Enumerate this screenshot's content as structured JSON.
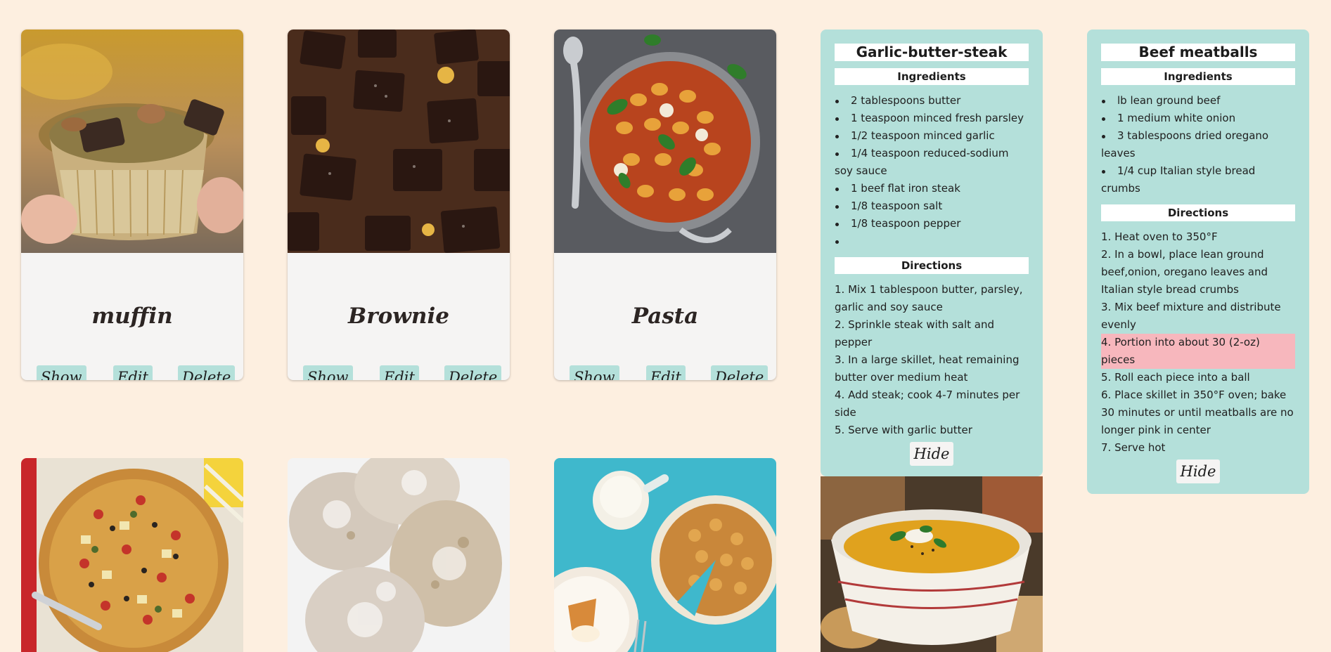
{
  "recipes": [
    {
      "title": "muffin",
      "show_label": "Show",
      "edit_label": "Edit",
      "delete_label": "Delete",
      "photo": "muffin-photo"
    },
    {
      "title": "Brownie",
      "show_label": "Show",
      "edit_label": "Edit",
      "delete_label": "Delete",
      "photo": "brownie-photo"
    },
    {
      "title": "Pasta",
      "show_label": "Show",
      "edit_label": "Edit",
      "delete_label": "Delete",
      "photo": "pasta-photo"
    }
  ],
  "bottom_photos": [
    "pizza-photo",
    "flatbread-photo",
    "tart-photo",
    "soup-photo"
  ],
  "details": [
    {
      "title": "Garlic-butter-steak",
      "ingredients_heading": "Ingredients",
      "ingredients": [
        "2 tablespoons butter",
        "1 teaspoon minced fresh parsley",
        "1/2 teaspoon minced garlic",
        "1/4 teaspoon reduced-sodium soy sauce",
        "1 beef flat iron steak",
        "1/8 teaspoon salt",
        "1/8 teaspoon pepper",
        ""
      ],
      "directions_heading": "Directions",
      "directions": [
        "1. Mix 1 tablespoon butter, parsley, garlic and soy sauce",
        "2. Sprinkle steak with salt and pepper",
        "3. In a large skillet, heat remaining butter over medium heat",
        "4. Add steak; cook 4-7 minutes per side",
        "5. Serve with garlic butter"
      ],
      "hide_label": "Hide"
    },
    {
      "title": "Beef meatballs",
      "ingredients_heading": "Ingredients",
      "ingredients": [
        "lb lean ground beef",
        "1 medium white onion",
        "3 tablespoons dried oregano leaves",
        "1/4 cup Italian style bread crumbs"
      ],
      "directions_heading": "Directions",
      "directions": [
        "1. Heat oven to 350°F",
        "2. In a bowl, place lean ground beef,onion, oregano leaves and Italian style bread crumbs",
        "3. Mix beef mixture and distribute evenly",
        "4. Portion into about 30 (2-oz) pieces",
        "5. Roll each piece into a ball",
        "6. Place skillet in 350°F oven; bake 30 minutes or until meatballs are no longer pink in center",
        "7. Serve hot"
      ],
      "highlighted_direction": "4. Portion into about 30 (2-oz) pieces",
      "hide_label": "Hide"
    }
  ],
  "colors": {
    "page_background": "#fdefe0",
    "card_background": "#f5f4f3",
    "accent_teal": "#b4e0da",
    "highlight_pink": "#f7b7bd"
  }
}
